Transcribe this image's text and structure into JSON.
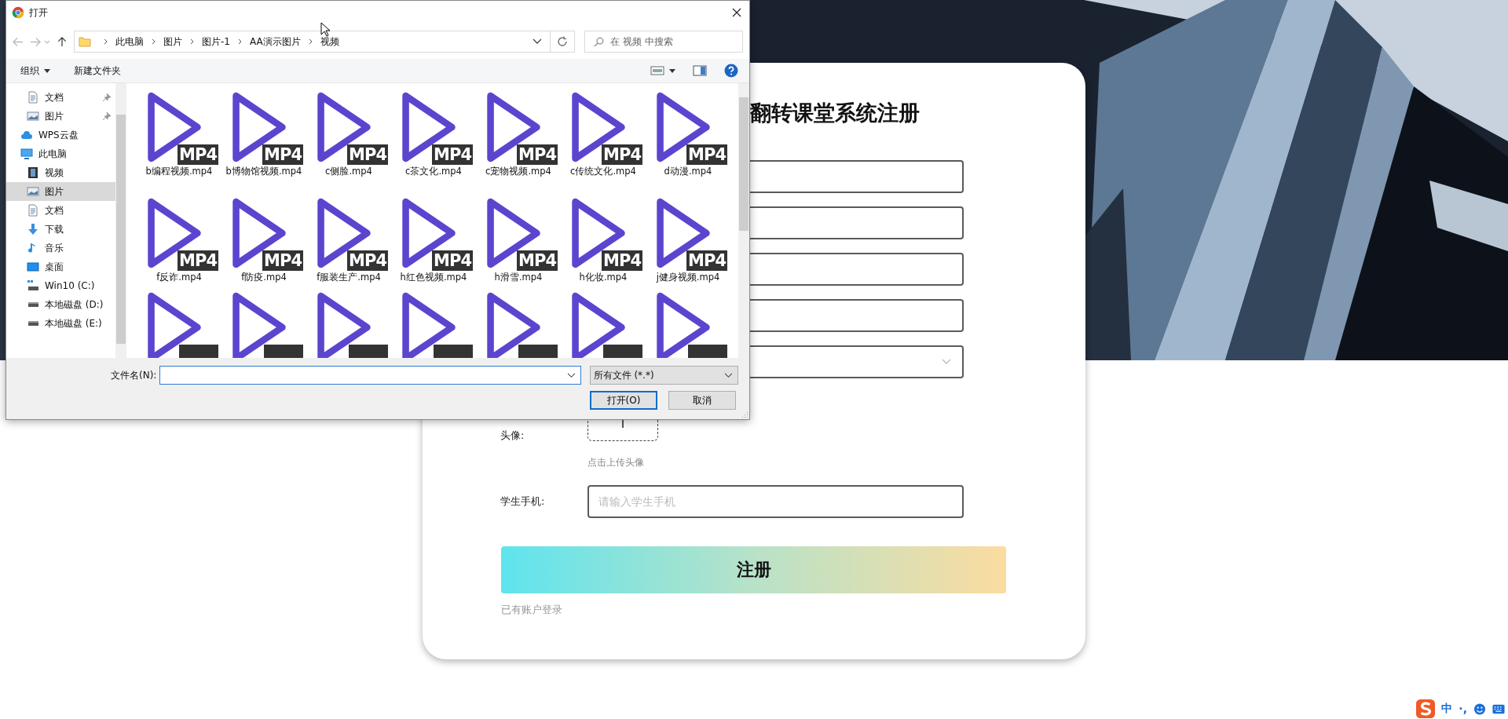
{
  "dialog": {
    "title": "打开",
    "breadcrumb": [
      "此电脑",
      "图片",
      "图片-1",
      "AA演示图片",
      "视频"
    ],
    "search": {
      "placeholder": "在 视频 中搜索"
    },
    "toolbar": {
      "organize": "组织",
      "new_folder": "新建文件夹"
    },
    "nav": [
      {
        "label": "文档",
        "kind": "doc",
        "pinned": true,
        "selected": false
      },
      {
        "label": "图片",
        "kind": "picture",
        "pinned": true,
        "selected": false
      },
      {
        "label": "WPS云盘",
        "kind": "cloud",
        "pinned": false,
        "selected": false
      },
      {
        "label": "此电脑",
        "kind": "pc",
        "pinned": false,
        "selected": false,
        "children": [
          {
            "label": "视频",
            "kind": "video",
            "selected": false
          },
          {
            "label": "图片",
            "kind": "picture",
            "selected": true
          },
          {
            "label": "文档",
            "kind": "doc",
            "selected": false
          },
          {
            "label": "下载",
            "kind": "download",
            "selected": false
          },
          {
            "label": "音乐",
            "kind": "music",
            "selected": false
          },
          {
            "label": "桌面",
            "kind": "desktop",
            "selected": false
          },
          {
            "label": "Win10 (C:)",
            "kind": "system-drive",
            "selected": false
          },
          {
            "label": "本地磁盘 (D:)",
            "kind": "drive",
            "selected": false
          },
          {
            "label": "本地磁盘 (E:)",
            "kind": "drive",
            "selected": false
          }
        ]
      }
    ],
    "files": [
      {
        "kind": "full",
        "name": "b编程视频.mp4",
        "badge": "MP4"
      },
      {
        "kind": "full",
        "name": "b博物馆视频.mp4",
        "badge": "MP4"
      },
      {
        "kind": "full",
        "name": "c侧脸.mp4",
        "badge": "MP4"
      },
      {
        "kind": "full",
        "name": "c茶文化.mp4",
        "badge": "MP4"
      },
      {
        "kind": "full",
        "name": "c宠物视频.mp4",
        "badge": "MP4"
      },
      {
        "kind": "full",
        "name": "c传统文化.mp4",
        "badge": "MP4"
      },
      {
        "kind": "full",
        "name": "d动漫.mp4",
        "badge": "MP4"
      },
      {
        "kind": "full",
        "name": "f反诈.mp4",
        "badge": "MP4"
      },
      {
        "kind": "full",
        "name": "f防疫.mp4",
        "badge": "MP4"
      },
      {
        "kind": "full",
        "name": "f服装生产.mp4",
        "badge": "MP4"
      },
      {
        "kind": "full",
        "name": "h红色视频.mp4",
        "badge": "MP4"
      },
      {
        "kind": "full",
        "name": "h滑雪.mp4",
        "badge": "MP4"
      },
      {
        "kind": "full",
        "name": "h化妆.mp4",
        "badge": "MP4"
      },
      {
        "kind": "full",
        "name": "j健身视频.mp4",
        "badge": "MP4"
      },
      {
        "kind": "cut"
      },
      {
        "kind": "cut"
      },
      {
        "kind": "cut"
      },
      {
        "kind": "cut"
      },
      {
        "kind": "cut"
      },
      {
        "kind": "cut"
      },
      {
        "kind": "cut"
      }
    ],
    "filename_label": "文件名(N):",
    "filetype": "所有文件 (*.*)",
    "buttons": [
      {
        "label": "打开(O)",
        "kind": "primary"
      },
      {
        "label": "取消",
        "kind": "normal"
      }
    ]
  },
  "form": {
    "title": "翻转课堂系统注册",
    "fields": [
      {
        "kind": "input"
      },
      {
        "kind": "input"
      },
      {
        "kind": "input"
      },
      {
        "kind": "input"
      },
      {
        "kind": "select"
      }
    ],
    "avatar": {
      "label": "头像:",
      "hint": "点击上传头像"
    },
    "phone": {
      "label": "学生手机:",
      "placeholder": "请输入学生手机"
    },
    "submit": "注册",
    "login_link": "已有账户登录"
  },
  "ime": {
    "mode": "中",
    "punct": "·,"
  }
}
